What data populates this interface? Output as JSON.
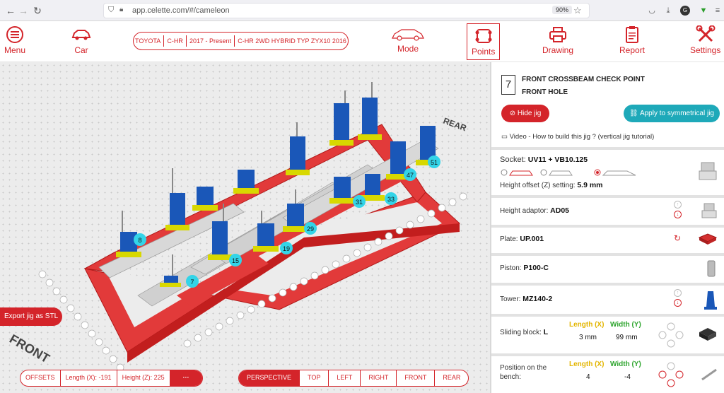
{
  "browser": {
    "url": "app.celette.com/#/cameleon",
    "zoom": "90%"
  },
  "header": {
    "menu_label": "Menu",
    "car_label": "Car",
    "vehicle": [
      "TOYOTA",
      "C-HR",
      "2017 - Present",
      "C-HR 2WD HYBRID TYP ZYX10 2016"
    ],
    "mode_label": "Mode",
    "points_label": "Points",
    "drawing_label": "Drawing",
    "report_label": "Report",
    "settings_label": "Settings"
  },
  "viewport": {
    "front_label": "FRONT",
    "rear_label": "REAR",
    "point_labels": [
      "7",
      "8",
      "15",
      "19",
      "29",
      "31",
      "33",
      "47",
      "51"
    ],
    "export_label": "Export jig as STL",
    "offsets": {
      "label": "OFFSETS",
      "length": "Length (X): -191",
      "height": "Height (Z): 225",
      "more": "···"
    },
    "views": [
      "PERSPECTIVE",
      "TOP",
      "LEFT",
      "RIGHT",
      "FRONT",
      "REAR"
    ],
    "active_view": "PERSPECTIVE"
  },
  "panel": {
    "point_number": "7",
    "title": "FRONT CROSSBEAM CHECK POINT",
    "subtitle": "FRONT HOLE",
    "hide_jig": "Hide jig",
    "apply_symmetrical": "Apply to symmetrical jig",
    "video_link": "Video - How to build this jig ? (vertical jig tutorial)",
    "socket_label": "Socket:",
    "socket_value": "UV11 + VB10.125",
    "height_offset_label": "Height offset (Z) setting:",
    "height_offset_value": "5.9 mm",
    "height_adaptor_label": "Height adaptor:",
    "height_adaptor_value": "AD05",
    "plate_label": "Plate:",
    "plate_value": "UP.001",
    "piston_label": "Piston:",
    "piston_value": "P100-C",
    "tower_label": "Tower:",
    "tower_value": "MZ140-2",
    "sliding_label": "Sliding block:",
    "sliding_value": "L",
    "length_x_header": "Length (X)",
    "width_y_header": "Width (Y)",
    "sliding_length": "3 mm",
    "sliding_width": "99 mm",
    "position_label": "Position on the bench:",
    "position_length": "4",
    "position_width": "-4"
  },
  "colors": {
    "brand_red": "#d4242a",
    "teal": "#1ea9b9",
    "tower_blue": "#1a57b8",
    "point_cyan": "#33d4e8"
  }
}
